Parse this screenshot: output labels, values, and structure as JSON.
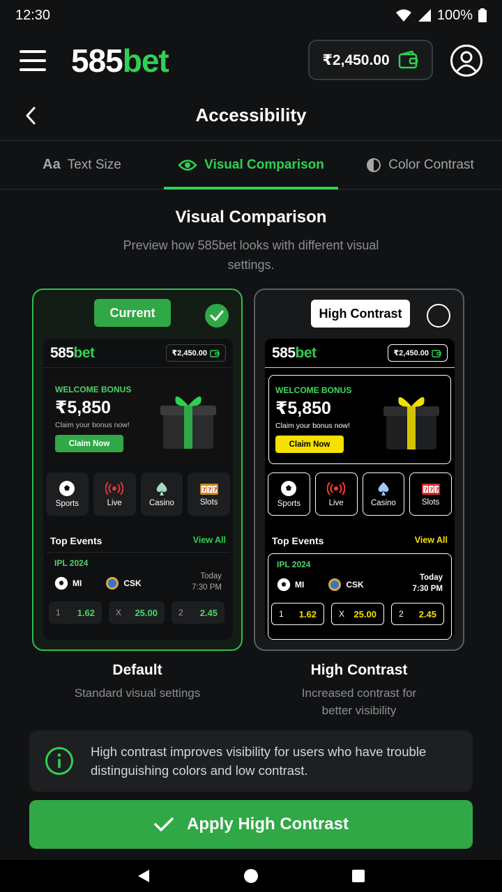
{
  "status": {
    "time": "12:30",
    "battery": "100%"
  },
  "appbar": {
    "logo_main": "585",
    "logo_accent": "bet",
    "balance": "₹2,450.00"
  },
  "titlebar": {
    "title": "Accessibility"
  },
  "tabs": [
    {
      "label": "Text Size"
    },
    {
      "label": "Visual Comparison"
    },
    {
      "label": "Color Contrast"
    }
  ],
  "section": {
    "title": "Visual Comparison",
    "subtitle": "Preview how 585bet looks with different visual settings."
  },
  "preview": {
    "logo_main": "585",
    "logo_accent": "bet",
    "balance": "₹2,450.00",
    "bonus_label": "WELCOME BONUS",
    "bonus_amount": "₹5,850",
    "bonus_text": "Claim your bonus now!",
    "claim_label": "Claim Now",
    "categories": [
      {
        "label": "Sports",
        "icon": "soccer-ball-icon"
      },
      {
        "label": "Live",
        "icon": "live-broadcast-icon"
      },
      {
        "label": "Casino",
        "icon": "spade-icon"
      },
      {
        "label": "Slots",
        "icon": "slot-machine-icon"
      }
    ],
    "events_title": "Top Events",
    "view_all": "View All",
    "league": "IPL 2024",
    "team1": "MI",
    "team2": "CSK",
    "time_day": "Today",
    "time_clock": "7:30 PM",
    "odds": [
      {
        "key": "1",
        "value": "1.62"
      },
      {
        "key": "X",
        "value": "25.00"
      },
      {
        "key": "2",
        "value": "2.45"
      }
    ]
  },
  "cards": {
    "default": {
      "badge": "Current",
      "title": "Default",
      "desc": "Standard visual settings"
    },
    "high_contrast": {
      "badge": "High Contrast",
      "title": "High Contrast",
      "desc": "Increased contrast for better visibility"
    }
  },
  "info": {
    "text": "High contrast improves visibility for users who have trouble distinguishing colors and low contrast."
  },
  "apply": {
    "label": "Apply High Contrast"
  },
  "colors": {
    "accent": "#2fd152",
    "button": "#2fa845",
    "hc_accent": "#f5e000",
    "background": "#111213"
  }
}
